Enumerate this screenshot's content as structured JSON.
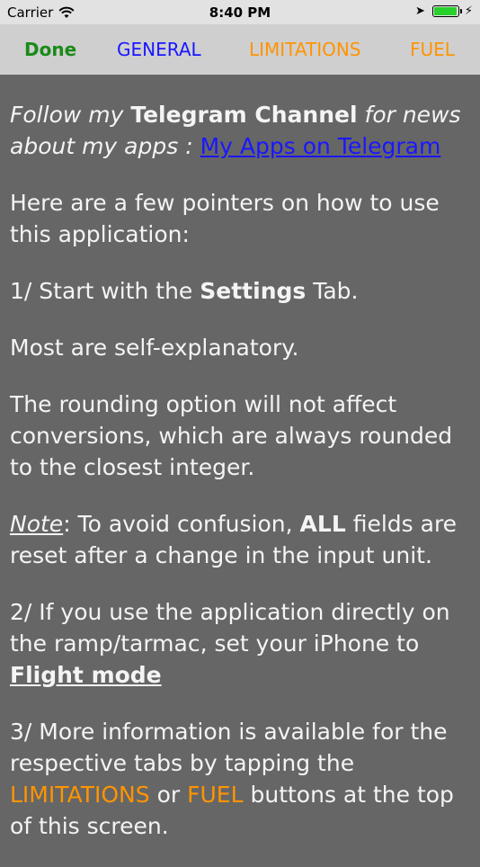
{
  "status_bar": {
    "carrier": "Carrier",
    "time": "8:40 PM"
  },
  "toolbar": {
    "done_label": "Done",
    "general_label": "GENERAL",
    "limitations_label": "LIMITATIONS",
    "fuel_label": "FUEL"
  },
  "colors": {
    "done": "#1a8a1a",
    "general": "#1a17ff",
    "limitations": "#ff9400",
    "fuel": "#ff9400",
    "background": "#666666",
    "text": "#f4f4f4"
  },
  "content": {
    "p1": {
      "follow": "Follow my",
      "telegram_channel": "Telegram Channel",
      "for_news": "for news about my apps :",
      "link": "My Apps on Telegram"
    },
    "p2": "Here are a few pointers on how to use this application:",
    "p3": {
      "pre": "1/ Start with the",
      "bold": "Settings",
      "post": "Tab."
    },
    "p4": "Most are self-explanatory.",
    "p5": "The rounding option will not affect conversions, which are always rounded to the closest integer.",
    "p6": {
      "note": "Note",
      "pre": ": To avoid confusion,",
      "bold": "ALL",
      "post": "fields are reset after a change in the input unit."
    },
    "p7": {
      "pre": "2/ If you use the application directly on the ramp/tarmac, set your iPhone to",
      "flight_mode": "Flight mode"
    },
    "p8": {
      "pre": "3/ More information is available for the respective tabs by tapping the",
      "limitations": "LIMITATIONS",
      "or": "or",
      "fuel": "FUEL",
      "post": "buttons at the top of this screen."
    }
  }
}
